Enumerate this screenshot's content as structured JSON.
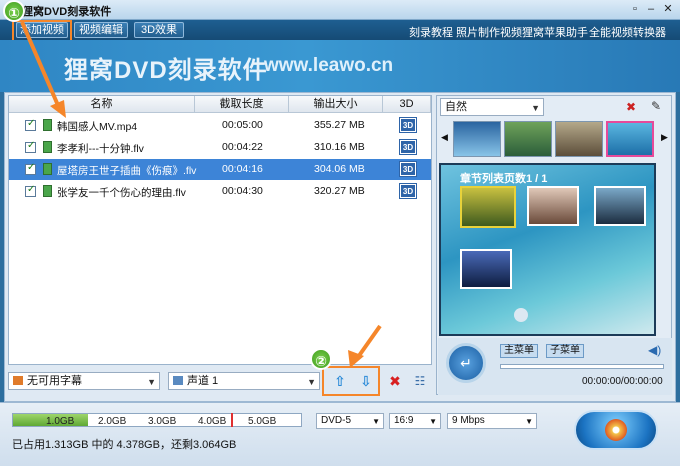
{
  "window": {
    "title": "狸窝DVD刻录软件"
  },
  "tabs": [
    {
      "label": "添加视频"
    },
    {
      "label": "视频编辑"
    },
    {
      "label": "3D效果"
    }
  ],
  "top_links": [
    "刻录教程",
    "照片制作视频",
    "狸窝苹果助手",
    "全能视频转换器"
  ],
  "banner": {
    "title": "狸窝DVD刻录软件",
    "url": "www.leawo.cn"
  },
  "table": {
    "headers": [
      "名称",
      "截取长度",
      "输出大小",
      "3D"
    ],
    "rows": [
      {
        "name": "韩国感人MV.mp4",
        "length": "00:05:00",
        "size": "355.27 MB"
      },
      {
        "name": "李孝利---十分钟.flv",
        "length": "00:04:22",
        "size": "310.16 MB"
      },
      {
        "name": "屋塔房王世子插曲《伤痕》.flv",
        "length": "00:04:16",
        "size": "304.06 MB"
      },
      {
        "name": "张学友一千个伤心的理由.flv",
        "length": "00:04:30",
        "size": "320.27 MB"
      }
    ],
    "badge_3d": "3D"
  },
  "bottom_left": {
    "subtitle": "无可用字幕",
    "audio": "声道 1"
  },
  "right": {
    "theme": "自然",
    "preview_title": "章节列表页数1 / 1",
    "menu_main": "主菜单",
    "menu_sub": "子菜单",
    "time": "00:00:00/00:00:00"
  },
  "status": {
    "ticks": [
      "1.0GB",
      "2.0GB",
      "3.0GB",
      "4.0GB",
      "5.0GB"
    ],
    "used_fraction": 0.26,
    "info": "已占用1.313GB 中的 4.378GB，还剩3.064GB",
    "disc": "DVD-5",
    "aspect": "16:9",
    "bitrate": "9 Mbps"
  },
  "annotations": [
    "①",
    "②"
  ],
  "colors": {
    "accent": "#3d84d7",
    "arrow": "#f5862a"
  }
}
